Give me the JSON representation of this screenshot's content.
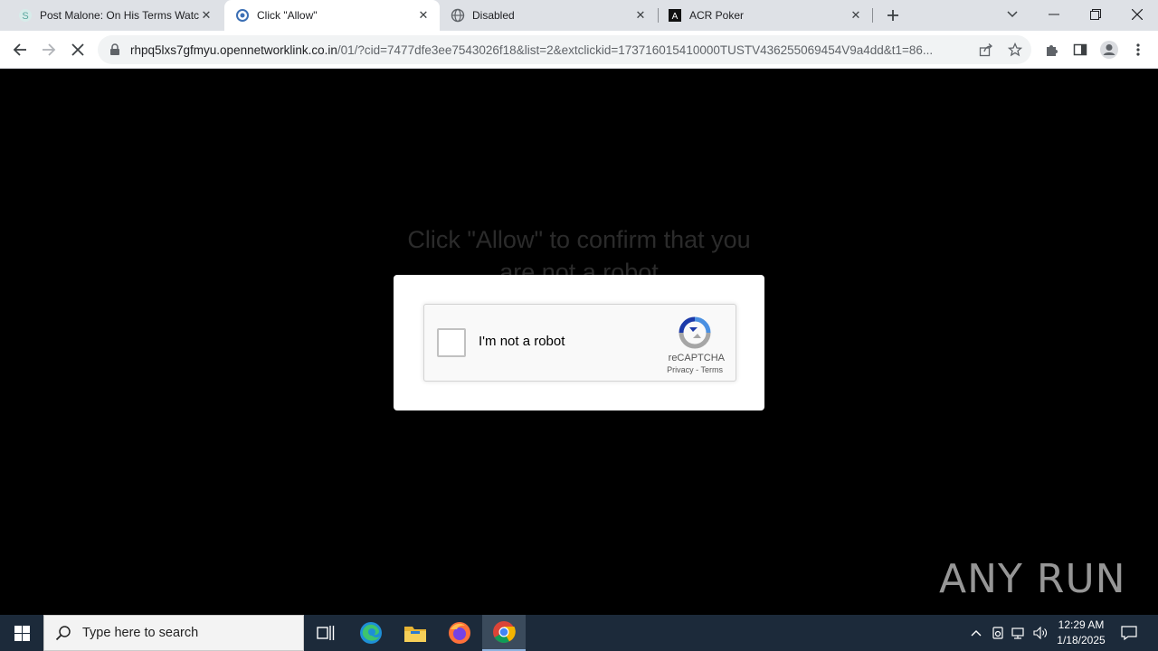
{
  "browser": {
    "tabs": [
      {
        "title": "Post Malone: On His Terms Watc",
        "favicon": "s-letter-icon",
        "active": false
      },
      {
        "title": "Click \"Allow\"",
        "favicon": "globe-loading-icon",
        "active": true
      },
      {
        "title": "Disabled",
        "favicon": "globe-icon",
        "active": false
      },
      {
        "title": "ACR Poker",
        "favicon": "acr-poker-icon",
        "active": false
      }
    ],
    "url_host": "rhpq5lxs7gfmyu.opennetworklink.co.in",
    "url_path": "/01/?cid=7477dfe3ee7543026f18&list=2&extclickid=173716015410000TUSTV436255069454V9a4dd&t1=86..."
  },
  "page": {
    "headline": "Click \"Allow\" to confirm that you are not a robot",
    "recaptcha": {
      "label": "I'm not a robot",
      "brand": "reCAPTCHA",
      "links": "Privacy - Terms"
    },
    "watermark": "ANY RUN"
  },
  "taskbar": {
    "search_placeholder": "Type here to search",
    "time": "12:29 AM",
    "date": "1/18/2025"
  },
  "colors": {
    "page_bg": "#000000",
    "recaptcha_blue": "#1c3aa9",
    "taskbar_bg": "#1c2a3a"
  }
}
